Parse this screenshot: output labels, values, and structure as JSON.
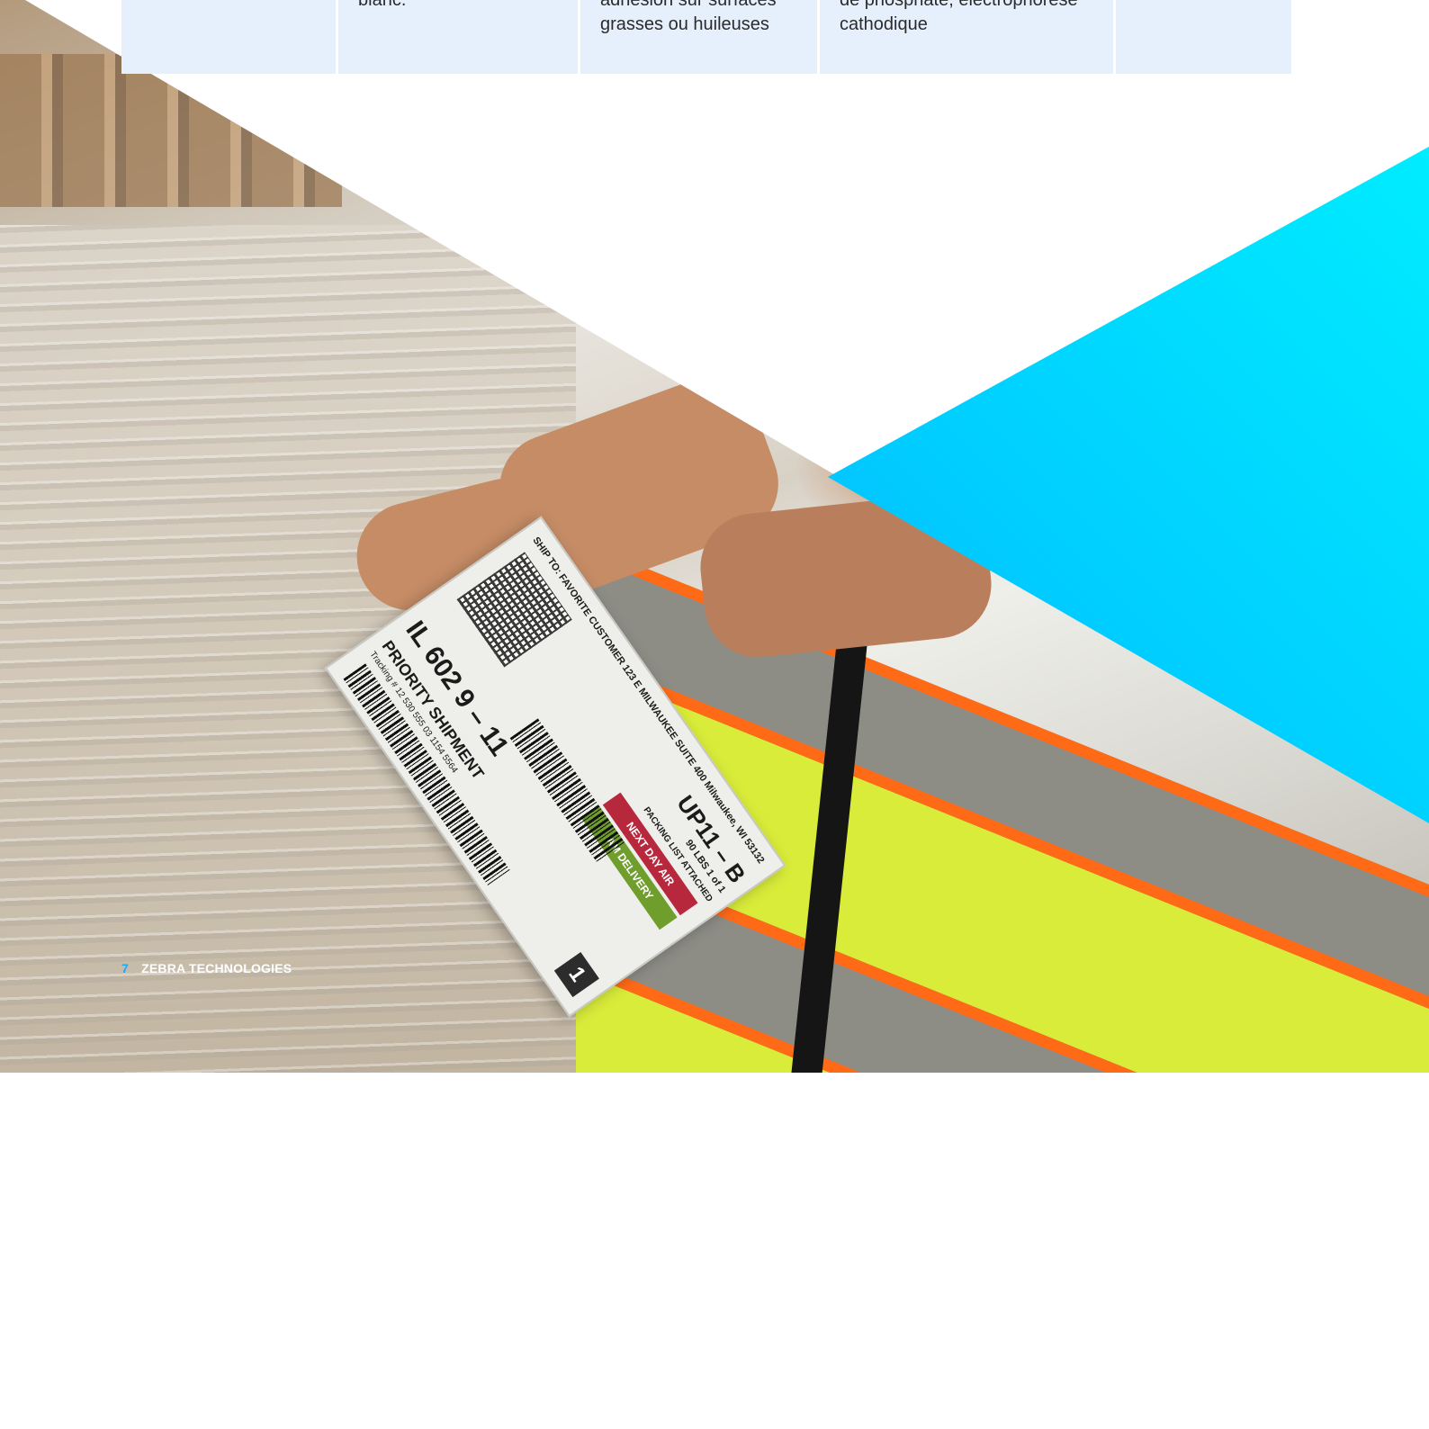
{
  "table_fragment": {
    "cells": [
      {
        "lines": []
      },
      {
        "lines": [
          "blanc."
        ]
      },
      {
        "lines": [
          "adhésion sur surfaces",
          "grasses ou huileuses"
        ]
      },
      {
        "lines": [
          "de phosphate, électrophorèse",
          "cathodique"
        ]
      },
      {
        "lines": []
      }
    ]
  },
  "shipping_label": {
    "ship_to": "SHIP TO: FAVORITE CUSTOMER 123 E MILWAUKEE SUITE 400 Milwaukee, WI 53132",
    "service_code": "UP11 – B",
    "weight": "90 LBS 1 of 1",
    "packing": "PACKING LIST ATTACHED",
    "tag_red": "NEXT DAY AIR",
    "tag_green": "AM DELIVERY",
    "route": "IL 602 9 – 11",
    "priority": "PRIORITY SHIPMENT",
    "tracking": "Tracking # 12 530 555 03 1154 5564",
    "package_number": "1"
  },
  "colors": {
    "table_bg": "#e6f0fc",
    "accent_cyan": "#00f2ff",
    "accent_blue": "#0a9dff",
    "page_number": "#1aa8ff"
  },
  "footer": {
    "page_number": "7",
    "brand": "ZEBRA TECHNOLOGIES"
  }
}
